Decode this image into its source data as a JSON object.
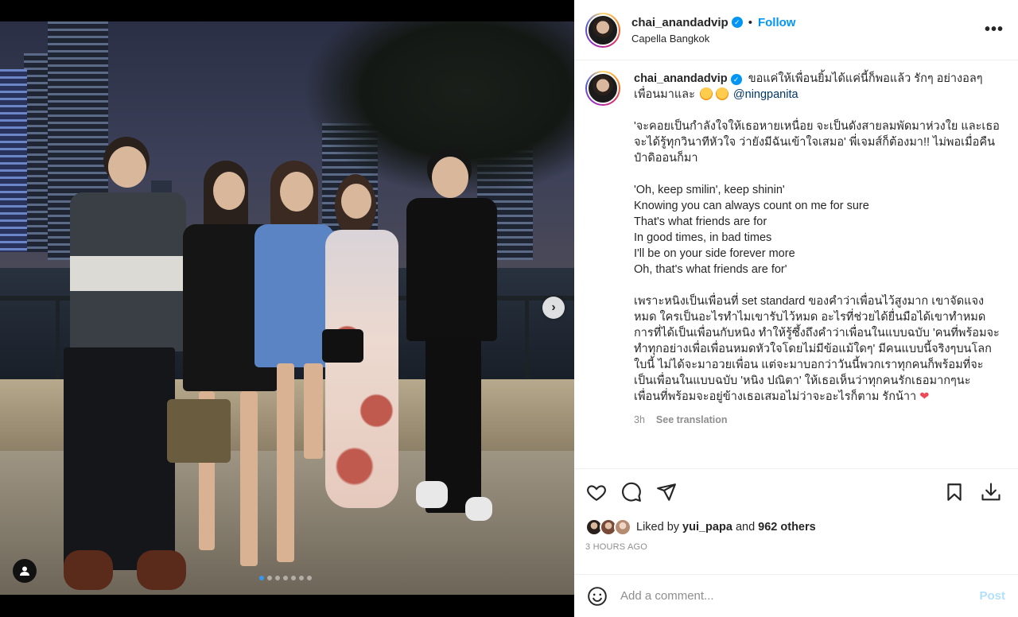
{
  "post": {
    "username": "chai_anandadvip",
    "verified_mark": "✓",
    "follow_label": "Follow",
    "separator": "•",
    "location": "Capella Bangkok",
    "more_label": "•••"
  },
  "caption": {
    "username": "chai_anandadvip",
    "line1": "ขอแค่ให้เพื่อนยิ้มได้แค่นี้ก็พอแล้ว รักๆ อย่างอลๆ เพื่อนมาและ",
    "mention": "@ningpanita",
    "para_thai_1": "'จะคอยเป็นกำลังใจให้เธอหายเหนื่อย จะเป็นดังสายลมพัดมาห่วงใย และเธอจะได้รู้ทุกวินาทีหัวใจ ว่ายังมีฉันเข้าใจเสมอ' พี่เจมส์ก็ต้องมา!! ไม่พอเมื่อคืนป๋าดิออนก็มา",
    "lyrics": "'Oh, keep smilin', keep shinin'\nKnowing you can always count on me for sure\nThat's what friends are for\nIn good times, in bad times\nI'll be on your side forever more\nOh, that's what friends are for'",
    "para_thai_2": "เพราะหนิงเป็นเพื่อนที่ set standard ของคำว่าเพื่อนไว้สูงมาก เขาจัดแจงหมด ใครเป็นอะไรทำไมเขารับไว้หมด อะไรที่ช่วยได้ยื่นมือได้เขาทำหมด การที่ได้เป็นเพื่อนกับหนิง ทำให้รู้ซึ้งถึงคำว่าเพื่อนในแบบฉบับ 'คนที่พร้อมจะทำทุกอย่างเพื่อเพื่อนหมดหัวใจโดยไม่มีข้อแม้ใดๆ' มีคนแบบนี้จริงๆบนโลกใบนี้ ไม่ได้จะมาอวยเพื่อน แต่จะมาบอกว่าวันนี้พวกเราทุกคนก็พร้อมที่จะเป็นเพื่อนในแบบฉบับ 'หนิง ปณิตา' ให้เธอเห็นว่าทุกคนรักเธอมากๆนะ เพื่อนที่พร้อมจะอยู่ข้างเธอเสมอไม่ว่าจะอะไรก็ตาม รักน้าา",
    "heart_emoji": "❤",
    "age": "3h",
    "see_translation": "See translation"
  },
  "likes": {
    "prefix": "Liked by",
    "user": "yui_papa",
    "and": "and",
    "count_text": "962 others"
  },
  "timestamp": "3 HOURS AGO",
  "comment": {
    "placeholder": "Add a comment...",
    "post_label": "Post"
  },
  "carousel": {
    "total": 7,
    "active_index": 0,
    "next_label": "›"
  },
  "colors": {
    "accent": "#0095f6",
    "post_disabled": "#b2dffc",
    "heart": "#ed4956",
    "active_dot": "#3797f0"
  },
  "icons": [
    "heart-icon",
    "comment-icon",
    "share-icon",
    "bookmark-icon",
    "download-icon",
    "emoji-icon",
    "user-tag-icon",
    "verified-icon",
    "more-icon",
    "chevron-right-icon"
  ]
}
